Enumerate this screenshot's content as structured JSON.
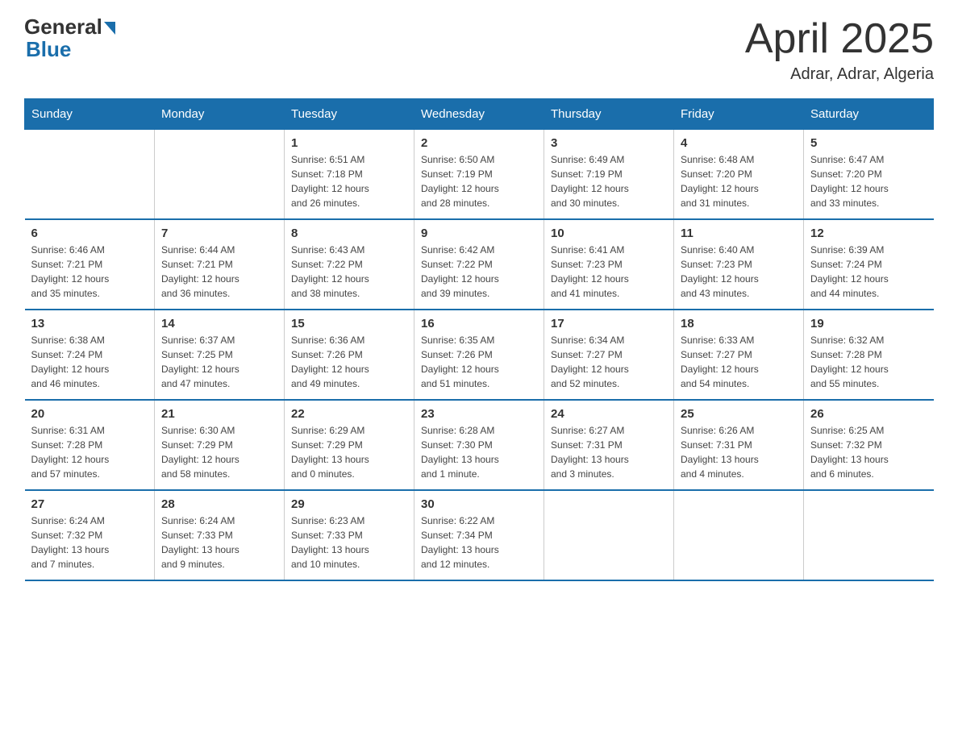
{
  "header": {
    "logo_general": "General",
    "logo_blue": "Blue",
    "month": "April 2025",
    "location": "Adrar, Adrar, Algeria"
  },
  "weekdays": [
    "Sunday",
    "Monday",
    "Tuesday",
    "Wednesday",
    "Thursday",
    "Friday",
    "Saturday"
  ],
  "weeks": [
    [
      {
        "day": "",
        "info": ""
      },
      {
        "day": "",
        "info": ""
      },
      {
        "day": "1",
        "info": "Sunrise: 6:51 AM\nSunset: 7:18 PM\nDaylight: 12 hours\nand 26 minutes."
      },
      {
        "day": "2",
        "info": "Sunrise: 6:50 AM\nSunset: 7:19 PM\nDaylight: 12 hours\nand 28 minutes."
      },
      {
        "day": "3",
        "info": "Sunrise: 6:49 AM\nSunset: 7:19 PM\nDaylight: 12 hours\nand 30 minutes."
      },
      {
        "day": "4",
        "info": "Sunrise: 6:48 AM\nSunset: 7:20 PM\nDaylight: 12 hours\nand 31 minutes."
      },
      {
        "day": "5",
        "info": "Sunrise: 6:47 AM\nSunset: 7:20 PM\nDaylight: 12 hours\nand 33 minutes."
      }
    ],
    [
      {
        "day": "6",
        "info": "Sunrise: 6:46 AM\nSunset: 7:21 PM\nDaylight: 12 hours\nand 35 minutes."
      },
      {
        "day": "7",
        "info": "Sunrise: 6:44 AM\nSunset: 7:21 PM\nDaylight: 12 hours\nand 36 minutes."
      },
      {
        "day": "8",
        "info": "Sunrise: 6:43 AM\nSunset: 7:22 PM\nDaylight: 12 hours\nand 38 minutes."
      },
      {
        "day": "9",
        "info": "Sunrise: 6:42 AM\nSunset: 7:22 PM\nDaylight: 12 hours\nand 39 minutes."
      },
      {
        "day": "10",
        "info": "Sunrise: 6:41 AM\nSunset: 7:23 PM\nDaylight: 12 hours\nand 41 minutes."
      },
      {
        "day": "11",
        "info": "Sunrise: 6:40 AM\nSunset: 7:23 PM\nDaylight: 12 hours\nand 43 minutes."
      },
      {
        "day": "12",
        "info": "Sunrise: 6:39 AM\nSunset: 7:24 PM\nDaylight: 12 hours\nand 44 minutes."
      }
    ],
    [
      {
        "day": "13",
        "info": "Sunrise: 6:38 AM\nSunset: 7:24 PM\nDaylight: 12 hours\nand 46 minutes."
      },
      {
        "day": "14",
        "info": "Sunrise: 6:37 AM\nSunset: 7:25 PM\nDaylight: 12 hours\nand 47 minutes."
      },
      {
        "day": "15",
        "info": "Sunrise: 6:36 AM\nSunset: 7:26 PM\nDaylight: 12 hours\nand 49 minutes."
      },
      {
        "day": "16",
        "info": "Sunrise: 6:35 AM\nSunset: 7:26 PM\nDaylight: 12 hours\nand 51 minutes."
      },
      {
        "day": "17",
        "info": "Sunrise: 6:34 AM\nSunset: 7:27 PM\nDaylight: 12 hours\nand 52 minutes."
      },
      {
        "day": "18",
        "info": "Sunrise: 6:33 AM\nSunset: 7:27 PM\nDaylight: 12 hours\nand 54 minutes."
      },
      {
        "day": "19",
        "info": "Sunrise: 6:32 AM\nSunset: 7:28 PM\nDaylight: 12 hours\nand 55 minutes."
      }
    ],
    [
      {
        "day": "20",
        "info": "Sunrise: 6:31 AM\nSunset: 7:28 PM\nDaylight: 12 hours\nand 57 minutes."
      },
      {
        "day": "21",
        "info": "Sunrise: 6:30 AM\nSunset: 7:29 PM\nDaylight: 12 hours\nand 58 minutes."
      },
      {
        "day": "22",
        "info": "Sunrise: 6:29 AM\nSunset: 7:29 PM\nDaylight: 13 hours\nand 0 minutes."
      },
      {
        "day": "23",
        "info": "Sunrise: 6:28 AM\nSunset: 7:30 PM\nDaylight: 13 hours\nand 1 minute."
      },
      {
        "day": "24",
        "info": "Sunrise: 6:27 AM\nSunset: 7:31 PM\nDaylight: 13 hours\nand 3 minutes."
      },
      {
        "day": "25",
        "info": "Sunrise: 6:26 AM\nSunset: 7:31 PM\nDaylight: 13 hours\nand 4 minutes."
      },
      {
        "day": "26",
        "info": "Sunrise: 6:25 AM\nSunset: 7:32 PM\nDaylight: 13 hours\nand 6 minutes."
      }
    ],
    [
      {
        "day": "27",
        "info": "Sunrise: 6:24 AM\nSunset: 7:32 PM\nDaylight: 13 hours\nand 7 minutes."
      },
      {
        "day": "28",
        "info": "Sunrise: 6:24 AM\nSunset: 7:33 PM\nDaylight: 13 hours\nand 9 minutes."
      },
      {
        "day": "29",
        "info": "Sunrise: 6:23 AM\nSunset: 7:33 PM\nDaylight: 13 hours\nand 10 minutes."
      },
      {
        "day": "30",
        "info": "Sunrise: 6:22 AM\nSunset: 7:34 PM\nDaylight: 13 hours\nand 12 minutes."
      },
      {
        "day": "",
        "info": ""
      },
      {
        "day": "",
        "info": ""
      },
      {
        "day": "",
        "info": ""
      }
    ]
  ]
}
